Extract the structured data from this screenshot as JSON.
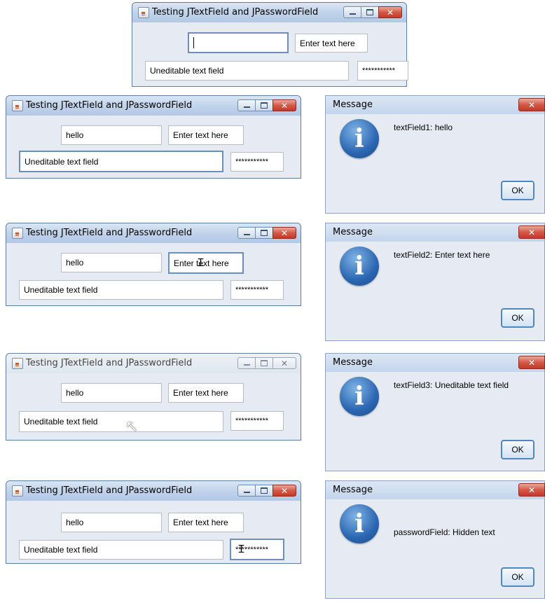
{
  "frame": {
    "title": "Testing JTextField and JPasswordField",
    "text_field_1_value": "hello",
    "text_field_2_value": "Enter text here",
    "text_field_3_value": "Uneditable text field",
    "password_masked": "***********"
  },
  "dialog": {
    "title": "Message",
    "ok_label": "OK",
    "messages": [
      "textField1: hello",
      "textField2: Enter text here",
      "textField3: Uneditable text field",
      "passwordField: Hidden text"
    ]
  },
  "icons": {
    "close_glyph": "✕",
    "info_glyph": "i",
    "text_caret": "Ｉ",
    "arrow_pointer": "↖"
  }
}
